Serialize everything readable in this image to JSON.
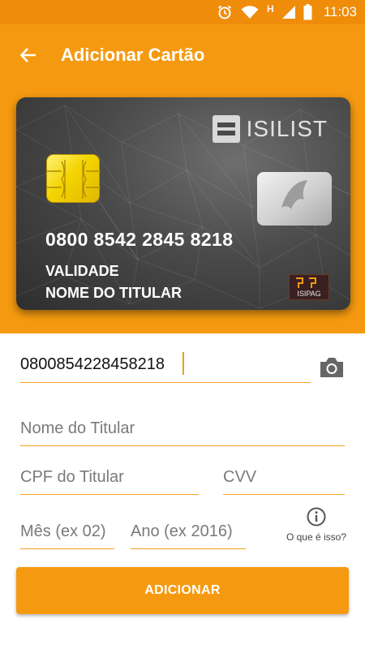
{
  "status_bar": {
    "time": "11:03",
    "network_label": "H",
    "icons": [
      "alarm-icon",
      "wifi-icon",
      "signal-icon",
      "battery-icon"
    ]
  },
  "app_bar": {
    "title": "Adicionar Cartão",
    "back_icon": "arrow-left-icon"
  },
  "card": {
    "brand": "ISILIST",
    "number": "0800 8542 2845 8218",
    "validity_label": "VALIDADE",
    "holder_label": "NOME DO TITULAR",
    "issuer": "ISIPAG"
  },
  "form": {
    "card_number_value": "0800854228458218",
    "holder_name_placeholder": "Nome do Titular",
    "cpf_placeholder": "CPF do Titular",
    "cvv_placeholder": "CVV",
    "month_placeholder": "Mês (ex 02)",
    "year_placeholder": "Ano (ex 2016)",
    "help_label": "O que é isso?",
    "submit_label": "ADICIONAR"
  },
  "colors": {
    "primary": "#f59a10",
    "status_bar": "#ef8c0a",
    "chip": "#f4d400"
  }
}
